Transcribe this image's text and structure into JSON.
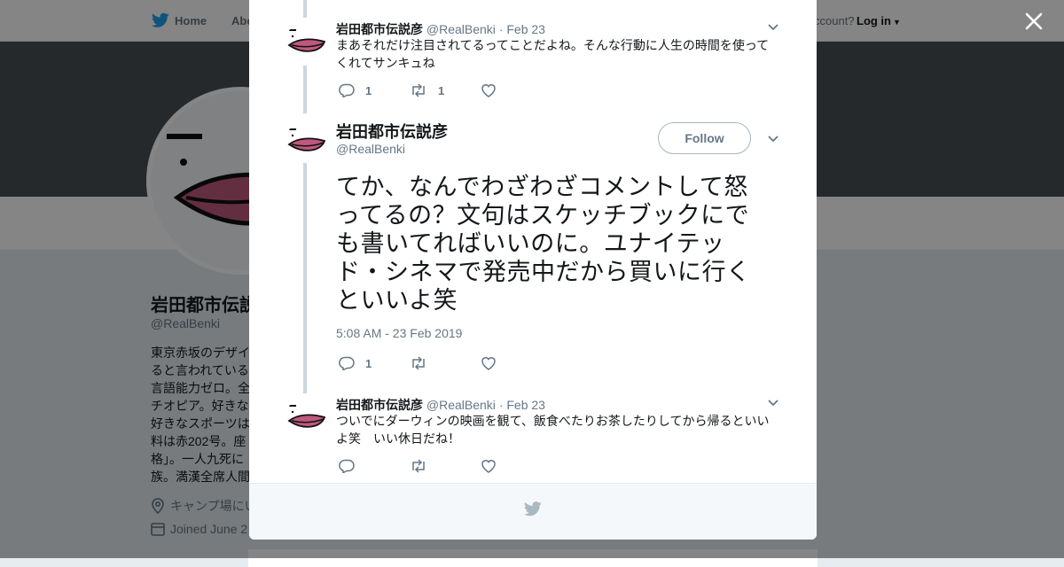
{
  "background": {
    "nav": {
      "home_label": "Home",
      "about_label": "Abo",
      "account_prompt": "ccount?",
      "login_label": "Log in"
    },
    "profile": {
      "name": "岩田都市伝説",
      "handle": "@RealBenki",
      "bio_lines": [
        "東京赤坂のデザイ",
        "ると言われている",
        "言語能力ゼロ。全",
        "チオピア。好きな",
        "好きなスポーツは",
        "料は赤202号。座",
        "格」。一人九死に",
        "族。満漢全席人間"
      ],
      "location": "キャンプ場にい",
      "joined": "Joined June 2"
    }
  },
  "tweets": [
    {
      "name": "岩田都市伝説彦",
      "handle": "@RealBenki",
      "date": "· Feb 23",
      "text": "まあそれだけ注目されてるってことだよね。そんな行動に人生の時間を使ってくれてサンキュね",
      "replies": "1",
      "retweets": "1",
      "likes": ""
    },
    {
      "name": "岩田都市伝説彦",
      "handle": "@RealBenki",
      "follow_label": "Follow",
      "text": "てか、なんでわざわざコメントして怒ってるの？文句はスケッチブックにでも書いてればいいのに。ユナイテッド・シネマで発売中だから買いに行くといいよ笑",
      "timestamp": "5:08 AM - 23 Feb 2019",
      "replies": "1",
      "retweets": "",
      "likes": ""
    },
    {
      "name": "岩田都市伝説彦",
      "handle": "@RealBenki",
      "date": "· Feb 23",
      "text": "ついでにダーウィンの映画を観て、飯食べたりお茶したりしてから帰るといいよ笑　いい休日だね！",
      "replies": "",
      "retweets": "",
      "likes": ""
    }
  ],
  "colors": {
    "brand_blue": "#1da1f2",
    "avatar_lips": "#c0587e",
    "text_gray": "#657786"
  },
  "icons": [
    "twitter-bird-icon",
    "close-icon",
    "chevron-down-icon",
    "reply-icon",
    "retweet-icon",
    "like-icon",
    "location-icon",
    "calendar-icon"
  ]
}
